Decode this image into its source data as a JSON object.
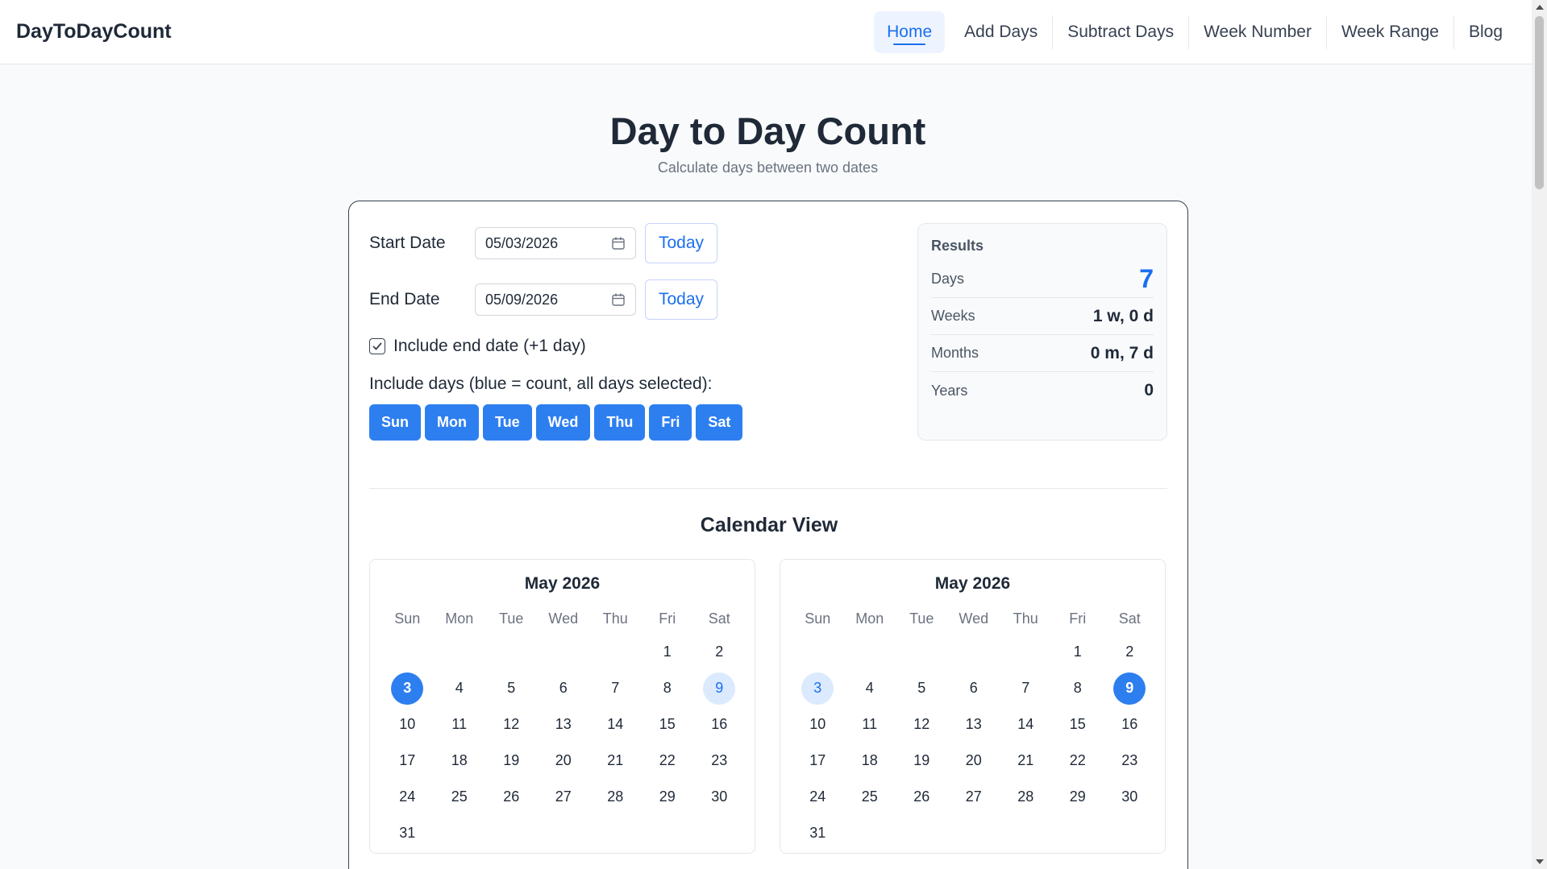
{
  "nav": {
    "brand": "DayToDayCount",
    "items": [
      {
        "label": "Home",
        "active": true
      },
      {
        "label": "Add Days"
      },
      {
        "label": "Subtract Days"
      },
      {
        "label": "Week Number"
      },
      {
        "label": "Week Range"
      },
      {
        "label": "Blog"
      }
    ]
  },
  "header": {
    "title": "Day to Day Count",
    "subtitle": "Calculate days between two dates"
  },
  "form": {
    "start_label": "Start Date",
    "start_value": "05/03/2026",
    "end_label": "End Date",
    "end_value": "05/09/2026",
    "today_label": "Today",
    "include_end_label": "Include end date (+1 day)",
    "include_end_checked": true,
    "days_label": "Include days (blue = count, all days selected):",
    "days": [
      "Sun",
      "Mon",
      "Tue",
      "Wed",
      "Thu",
      "Fri",
      "Sat"
    ]
  },
  "results": {
    "title": "Results",
    "rows": [
      {
        "label": "Days",
        "value": "7"
      },
      {
        "label": "Weeks",
        "value": "1 w, 0 d"
      },
      {
        "label": "Months",
        "value": "0 m, 7 d"
      },
      {
        "label": "Years",
        "value": "0"
      }
    ]
  },
  "calendar_view": {
    "title": "Calendar View",
    "weekdays": [
      "Sun",
      "Mon",
      "Tue",
      "Wed",
      "Thu",
      "Fri",
      "Sat"
    ],
    "calendars": [
      {
        "title": "May 2026",
        "first_weekday": 5,
        "days_in_month": 31,
        "selected": 3,
        "highlighted": 9
      },
      {
        "title": "May 2026",
        "first_weekday": 5,
        "days_in_month": 31,
        "selected": 9,
        "highlighted": 3
      }
    ]
  },
  "colors": {
    "accent": "#1a6ff0",
    "button_blue": "#2d7ff0",
    "highlight_soft": "#dbeafe"
  }
}
